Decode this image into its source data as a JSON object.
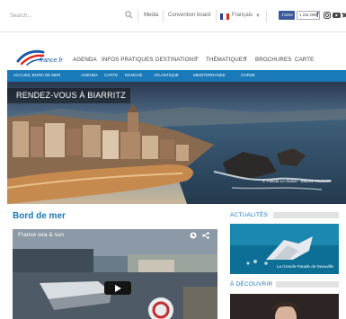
{
  "topbar": {
    "search_placeholder": "Search...",
    "media": "Media",
    "convention": "Convention board",
    "language": "Français",
    "fb_like": "J'aime",
    "fb_count": "1 211 000",
    "social_icons": [
      "facebook-icon",
      "instagram-icon",
      "youtube-icon",
      "twitter-icon"
    ]
  },
  "brand": {
    "logo_text": "france.fr",
    "logo_colors": [
      "#1e5aa8",
      "#e2231a"
    ]
  },
  "mainnav": [
    {
      "label": "AGENDA",
      "chevron": false
    },
    {
      "label": "INFOS PRATIQUES",
      "chevron": false
    },
    {
      "label": "DESTINATIONS",
      "chevron": true
    },
    {
      "label": "THÉMATIQUES",
      "chevron": true
    },
    {
      "label": "BROCHURES",
      "chevron": false
    },
    {
      "label": "CARTE",
      "chevron": false
    }
  ],
  "subnav": [
    "ACCUEIL BORD DE MER",
    "AGENDA",
    "CARTE",
    "MANCHE",
    "ATLANTIQUE",
    "MEDITERRANEE",
    "CORSE"
  ],
  "hero": {
    "title": "RENDEZ-VOUS À BIARRITZ",
    "credit": "© Pascal Le Doare - Biarritz Tourisme"
  },
  "content": {
    "section_title": "Bord de mer",
    "video_title": "France sea & sun"
  },
  "sidebar": {
    "news_heading": "ACTUALITÉS",
    "news_caption": "La Grande Parade de Deauville",
    "discover_heading": "À DÉCOUVRIR"
  },
  "colors": {
    "accent": "#1a79b8",
    "facebook": "#3b5998"
  }
}
